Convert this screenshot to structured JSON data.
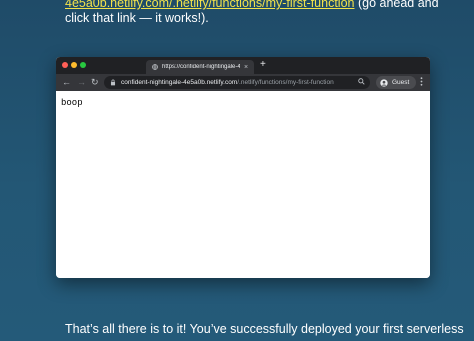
{
  "article": {
    "intro_link": "4e5a0b.netlify.com/.netlify/functions/my-first-function",
    "intro_rest": " (go ahead and click that link — it works!).",
    "closing": "That’s all there is to it! You’ve successfully deployed your first serverless"
  },
  "browser": {
    "tab_title": "https://confident-nightingale-4e",
    "tab_close": "×",
    "new_tab": "+",
    "url_host": "confident-nightingale-4e5a0b.netlify.com",
    "url_path": "/.netlify/functions/my-first-function",
    "profile_label": "Guest",
    "page_body": "boop",
    "nav_back": "←",
    "nav_forward": "→",
    "nav_reload": "↻"
  },
  "colors": {
    "background": "#235775",
    "link": "#f2e24a",
    "chrome_dark": "#202124",
    "chrome_toolbar": "#35363a"
  },
  "icons": [
    "globe-icon",
    "lock-icon",
    "zoom-icon",
    "avatar-icon",
    "kebab-menu-icon"
  ]
}
